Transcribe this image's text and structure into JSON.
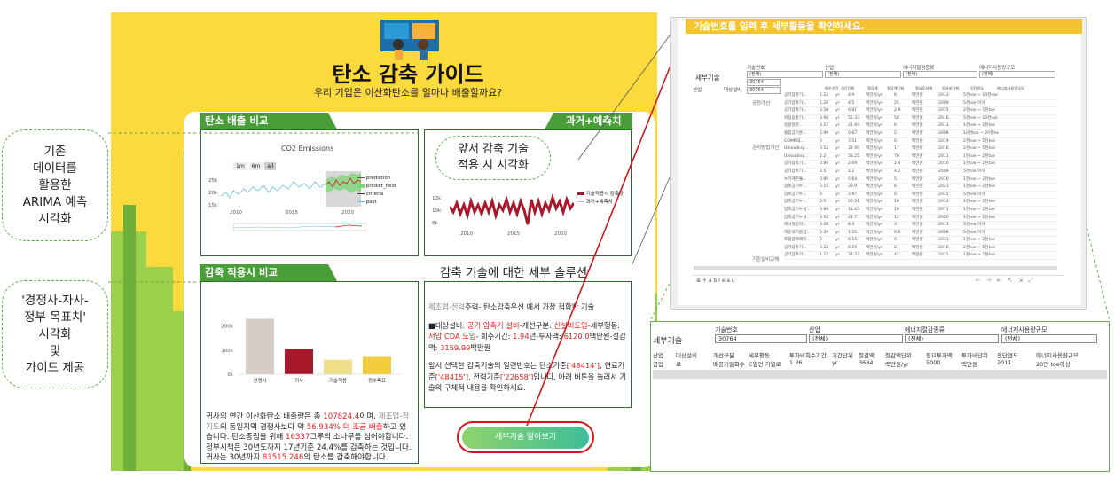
{
  "callouts": {
    "arima": "기존\n데이터를\n활용한\nARIMA 예측\n시각화",
    "competitor": "'경쟁사-자사-\n정부 목표치'\n시각화\n및\n가이드 제공",
    "reduction_viz": "앞서 감축 기술\n적용 시 시각화",
    "detail_solution": "감축 기술에 대한 세부 솔루션"
  },
  "header": {
    "title": "탄소 감축 가이드",
    "subtitle": "우리 기업은 이산화탄소를 얼마나 배출할까요?"
  },
  "sections": {
    "emission_compare": "탄소 배출 비교",
    "past_forecast": "과거+예측치 시각화",
    "reduction_compare": "감축 적용시 비교"
  },
  "co2_chart": {
    "title": "CO2 Emissions",
    "range_buttons": [
      "1m",
      "6m",
      "all"
    ],
    "legend": [
      "prediction",
      "predict_field",
      "criteria",
      "past"
    ],
    "yticks": [
      "25k",
      "20k",
      "15k"
    ],
    "xticks": [
      "2010",
      "2015",
      "2020"
    ]
  },
  "reduction_line_chart": {
    "legend": [
      "기술적용시 감축량",
      "과거+예측치"
    ],
    "yticks": [
      "12k",
      "10k",
      "8k"
    ],
    "xticks": [
      "2010",
      "2015",
      "2020"
    ]
  },
  "chart_data": {
    "type": "bar",
    "categories": [
      "경쟁사",
      "귀사",
      "기술적용",
      "정부목표"
    ],
    "values": [
      230000,
      105000,
      60000,
      75000
    ],
    "ylim": [
      0,
      250000
    ],
    "yticks": [
      "200k",
      "100k",
      "0k"
    ],
    "colors": [
      "#d6cdc6",
      "#a8182b",
      "#f0e08a",
      "#f4cd3a"
    ]
  },
  "comment": {
    "p1_a": "귀사의 연간 이산화탄소 배출량은 총 ",
    "p1_val": "107824.4",
    "p1_b": "이며, ",
    "p1_gray": "제조업-정기도",
    "p1_c": "의 동일지역 경쟁사보다 약 ",
    "p1_pct": "56.934% 더 조금 배출",
    "p1_d": "하고 있습니다. 탄소중립을 위해 ",
    "p1_trees": "16337",
    "p1_e": "그루의 소나무를 심어야합니다.",
    "p2": "정부시책은 30년도까지 17년기준 24.4%를 감축하는 것입니다.",
    "p3_a": "귀사는 30년까지 ",
    "p3_val": "81515.246",
    "p3_b": "의 탄소를 감축해야합니다."
  },
  "detail": {
    "l1_gray": "제조업-전력",
    "l1_b": "주력- 탄소감축",
    "l1_c": "우선 에서 가장 적합한 기술",
    "l2_a": "■대상설비: ",
    "l2_red1": "공기 압축기 설비",
    "l2_b": "-개선구분: ",
    "l2_red2": "신설비도입",
    "l2_c": "-세부행동: ",
    "l2_red3": "저압 CDA 도입",
    "l2_d": "- 회수기간: ",
    "l2_red4": "1.94",
    "l2_e": "년-투자액: ",
    "l2_red5": "6120.0",
    "l2_f": "백만원-절감액: ",
    "l2_red6": "3159.99",
    "l2_g": "백만원",
    "l3_a": "앞서 선택한 감축기술의 일련번호는 탄소기준",
    "l3_red1": "['48414']",
    "l3_b": ", 연료기준",
    "l3_red2": "['48415']",
    "l3_c": ", 전력기준",
    "l3_red3": "['22658']",
    "l3_d": "입니다. 아래 버튼을 눌러서 기술의 구체적 내용을 확인하세요."
  },
  "cta_label": "세부기술 알아보기",
  "tableau": {
    "header": "기술번호를 입력 후 세부활동을 확인하세요.",
    "sheet_title": "세부기술",
    "filter_labels": [
      "기술번호",
      "산업",
      "에너지절감종류",
      "에너지사용량규모"
    ],
    "filter_values": [
      "(전체)",
      "(전체)",
      "(전체)",
      "(전체)"
    ],
    "dropdown_items": [
      "30764",
      "30764"
    ],
    "footer": "⊕ + a b l e a u",
    "row_labels": [
      "산업",
      "대상설비"
    ],
    "groups": [
      "공정개선",
      "관리방법개선",
      "기존설비교체"
    ],
    "rows": [
      [
        "공기압축기...",
        "1.22",
        "yr",
        "4.9",
        "백만원/yr",
        "6",
        "백만원",
        "2013",
        "5천toe ~ 10천toe"
      ],
      [
        "공기압축기...",
        "1.26",
        "yr",
        "4.5",
        "백만원/yr",
        "25",
        "백만원",
        "2009",
        "5천toe 이하"
      ],
      [
        "공기압축기...",
        "3.58",
        "yr",
        "0.81",
        "백만원/yr",
        "2.9",
        "백만원",
        "2015",
        "2천toe ~ 5천toe"
      ],
      [
        "피팅송풍기...",
        "0.96",
        "yr",
        "52.33",
        "백만원/yr",
        "50",
        "백만원",
        "2016",
        "5천toe ~ 10천toe"
      ],
      [
        "용량원관...",
        "0.27",
        "yr",
        "21.94",
        "백만원/yr",
        "6",
        "백만원",
        "2013",
        "1천toe ~ 2천toe"
      ],
      [
        "흡입공기온...",
        "2.99",
        "yr",
        "0.67",
        "백만원/yr",
        "2",
        "백만원",
        "2008",
        "10천toe ~ 20천toe"
      ],
      [
        "COMP.대...",
        "0",
        "yr",
        "7.51",
        "백만원/yr",
        "0",
        "백만원",
        "2019",
        "2천toe ~ 5천toe"
      ],
      [
        "Unloading...",
        "0.52",
        "yr",
        "32.90",
        "백만원/yr",
        "17",
        "백만원",
        "2016",
        "2천toe ~ 5천toe"
      ],
      [
        "Unloading...",
        "1.2",
        "yr",
        "58.25",
        "백만원/yr",
        "70",
        "백만원",
        "2011",
        "1천toe ~ 2천toe"
      ],
      [
        "공기압축기...",
        "0.89",
        "yr",
        "2.69",
        "백만원/yr",
        "2.4",
        "백만원",
        "2016",
        "1천toe ~ 2천toe"
      ],
      [
        "공기압축기...",
        "3.5",
        "yr",
        "1.2",
        "백만원/yr",
        "4.2",
        "백만원",
        "2009",
        "5천toe 이하"
      ],
      [
        "누기계한율...",
        "0.89",
        "yr",
        "5.64",
        "백만원/yr",
        "5",
        "백만원",
        "2016",
        "1천toe ~ 2천toe"
      ],
      [
        "압축공기누...",
        "0.15",
        "yr",
        "39.9",
        "백만원/yr",
        "6",
        "백만원",
        "2021",
        "1천toe ~ 2천toe"
      ],
      [
        "압축공기누...",
        "0",
        "yr",
        "3.97",
        "백만원/yr",
        "0",
        "백만원",
        "2015",
        "5천toe 이하"
      ],
      [
        "압축공기누...",
        "0.5",
        "yr",
        "20.31",
        "백만원/yr",
        "10",
        "백만원",
        "2013",
        "1천toe ~ 2천toe"
      ],
      [
        "압축공기누설...",
        "0.86",
        "yr",
        "11.65",
        "백만원/yr",
        "10",
        "백만원",
        "2011",
        "1천toe ~ 2천toe"
      ],
      [
        "압축공기누설...",
        "0.55",
        "yr",
        "21.7",
        "백만원/yr",
        "12",
        "백만원",
        "2020",
        "1천toe ~ 2천toe"
      ],
      [
        "에너절압력...",
        "0.36",
        "yr",
        "8.3",
        "백만원/yr",
        "3",
        "백만원",
        "2011",
        "5천toe 이하"
      ],
      [
        "적운의기흡압...",
        "0.39",
        "yr",
        "1.55",
        "백만원/yr",
        "0.6",
        "백만원",
        "2008",
        "5천toe 이하"
      ],
      [
        "토출압력제어...",
        "0",
        "yr",
        "8.15",
        "백만원/yr",
        "0",
        "백만원",
        "2011",
        "1천toe ~ 2천toe"
      ],
      [
        "공기압축기...",
        "0.32",
        "yr",
        "6.19",
        "백만원/yr",
        "2",
        "백만원",
        "2016",
        "2천toe ~ 5천toe"
      ],
      [
        "공기압축기...",
        "1.22",
        "yr",
        "34.32",
        "백만원/yr",
        "42",
        "백만원",
        "2021",
        "1천toe ~ 2천toe"
      ]
    ],
    "col_headers": [
      "회수기간",
      "기간단위",
      "절감액",
      "절감액단위",
      "필요투자액",
      "투자비단위",
      "진단연도",
      "에너지사용량규모"
    ]
  },
  "zoom": {
    "sheet_title": "세부기술",
    "filter_labels": [
      "기술번호",
      "산업",
      "에너지절감종류",
      "에너지사용량규모"
    ],
    "filter_values": [
      "30764",
      "(전체)",
      "(전체)",
      "(전체)"
    ],
    "col_headers": [
      "산업",
      "대상설비",
      "개선구분",
      "세부활동",
      "투자비회수기간",
      "기간단위",
      "절감액",
      "절감액단위",
      "필요투자액",
      "투자비단위",
      "진단연도",
      "에너지사용량규모"
    ],
    "row": [
      "공업",
      "로",
      "배공기일회수",
      "C열연 가열로",
      "1.36",
      "yr",
      "3684",
      "백만원/yr",
      "5000",
      "백만원",
      "2011",
      "20만 toe이상"
    ]
  }
}
